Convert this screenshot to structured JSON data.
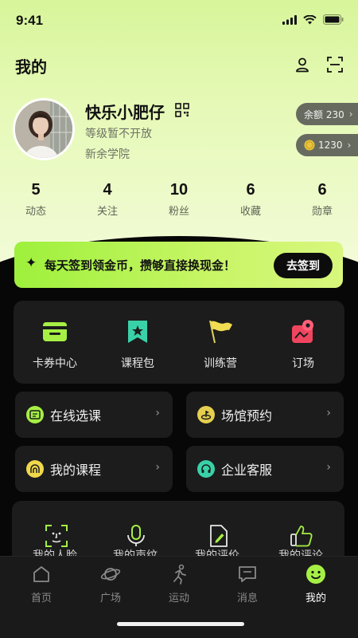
{
  "status_bar": {
    "time": "9:41"
  },
  "header": {
    "title": "我的",
    "profile_icon": "user-icon",
    "scan_icon": "scan-icon"
  },
  "profile": {
    "name": "快乐小肥仔",
    "level": "等级暂不开放",
    "school": "新余学院",
    "balance_label": "余额 230",
    "coins_label": "1230"
  },
  "stats": [
    {
      "value": "5",
      "label": "动态"
    },
    {
      "value": "4",
      "label": "关注"
    },
    {
      "value": "10",
      "label": "粉丝"
    },
    {
      "value": "6",
      "label": "收藏"
    },
    {
      "value": "6",
      "label": "勋章"
    }
  ],
  "signin": {
    "text": "每天签到领金币，攒够直接换现金！",
    "button": "去签到"
  },
  "quick_actions": [
    {
      "label": "卡券中心",
      "icon": "card-wallet-icon"
    },
    {
      "label": "课程包",
      "icon": "bookmark-star-icon"
    },
    {
      "label": "训练营",
      "icon": "flag-icon"
    },
    {
      "label": "订场",
      "icon": "map-pin-icon"
    }
  ],
  "entries": [
    {
      "label": "在线选课",
      "icon": "screen-icon"
    },
    {
      "label": "场馆预约",
      "icon": "venue-icon"
    },
    {
      "label": "我的课程",
      "icon": "course-icon"
    },
    {
      "label": "企业客服",
      "icon": "headset-icon"
    }
  ],
  "tools": [
    {
      "label": "我的人脸",
      "icon": "face-scan-icon"
    },
    {
      "label": "我的声纹",
      "icon": "microphone-icon"
    },
    {
      "label": "我的评价",
      "icon": "edit-doc-icon"
    },
    {
      "label": "我的评论",
      "icon": "thumbs-up-icon"
    }
  ],
  "tabs": [
    {
      "label": "首页",
      "icon": "home-icon"
    },
    {
      "label": "广场",
      "icon": "planet-icon"
    },
    {
      "label": "运动",
      "icon": "run-icon"
    },
    {
      "label": "消息",
      "icon": "message-icon"
    },
    {
      "label": "我的",
      "icon": "smile-icon",
      "active": true
    }
  ],
  "colors": {
    "accent": "#a8f046",
    "panel": "#1c1c1c",
    "background": "#070707"
  }
}
